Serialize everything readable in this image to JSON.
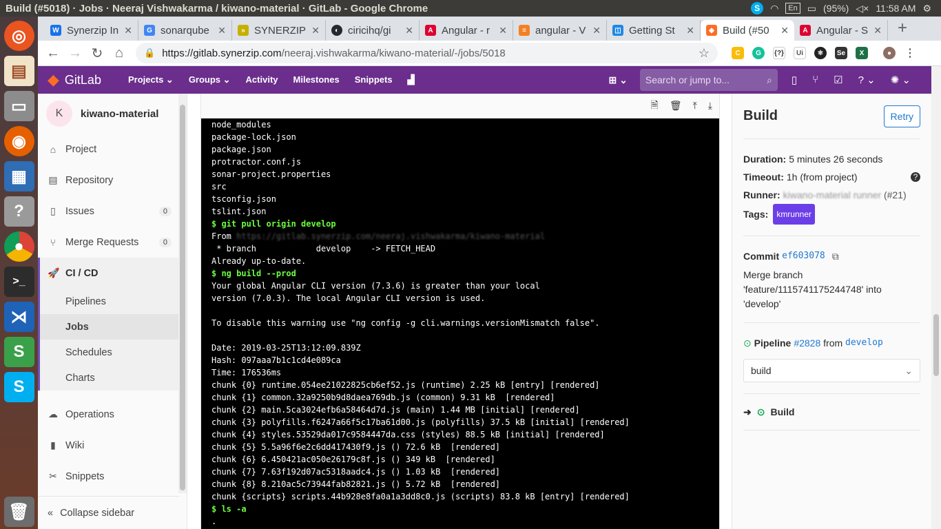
{
  "os": {
    "window_title": "Build (#5018) · Jobs · Neeraj Vishwakarma / kiwano-material · GitLab - Google Chrome",
    "lang": "En",
    "battery": "(95%)",
    "clock": "11:58 AM"
  },
  "browser": {
    "tabs": [
      {
        "title": "Synerzip In",
        "color": "#1a73e8"
      },
      {
        "title": "sonarqube",
        "color": "#4285f4"
      },
      {
        "title": "SYNERZIP",
        "color": "#c5b000"
      },
      {
        "title": "ciricihq/gi",
        "color": "#24292e"
      },
      {
        "title": "Angular - r",
        "color": "#dd0031"
      },
      {
        "title": "angular - V",
        "color": "#f48024"
      },
      {
        "title": "Getting St",
        "color": "#1e88e5"
      },
      {
        "title": "Build (#50",
        "color": "#fc6d26",
        "active": true
      },
      {
        "title": "Angular - S",
        "color": "#dd0031"
      }
    ],
    "url_host": "https://gitlab.synerzip.com",
    "url_path": "/neeraj.vishwakarma/kiwano-material/-/jobs/5018"
  },
  "gitlab": {
    "brand": "GitLab",
    "nav": [
      "Projects ⌄",
      "Groups ⌄",
      "Activity",
      "Milestones",
      "Snippets"
    ],
    "search_placeholder": "Search or jump to..."
  },
  "sidebar": {
    "project_initial": "K",
    "project_name": "kiwano-material",
    "items": [
      {
        "label": "Project"
      },
      {
        "label": "Repository"
      },
      {
        "label": "Issues",
        "count": "0"
      },
      {
        "label": "Merge Requests",
        "count": "0"
      },
      {
        "label": "CI / CD"
      }
    ],
    "cicd_sub": [
      "Pipelines",
      "Jobs",
      "Schedules",
      "Charts"
    ],
    "lower_items": [
      "Operations",
      "Wiki",
      "Snippets"
    ],
    "collapse": "Collapse sidebar"
  },
  "log": {
    "lines": [
      {
        "t": "node_modules"
      },
      {
        "t": "package-lock.json"
      },
      {
        "t": "package.json"
      },
      {
        "t": "protractor.conf.js"
      },
      {
        "t": "sonar-project.properties"
      },
      {
        "t": "src"
      },
      {
        "t": "tsconfig.json"
      },
      {
        "t": "tslint.json"
      },
      {
        "t": "$ git pull origin develop",
        "cmd": true
      },
      {
        "t": "From ",
        "blur": "https://gitlab.synerzip.com/neeraj.vishwakarma/kiwano-material"
      },
      {
        "t": " * branch            develop    -> FETCH_HEAD"
      },
      {
        "t": "Already up-to-date."
      },
      {
        "t": "$ ng build --prod",
        "cmd": true
      },
      {
        "t": "Your global Angular CLI version (7.3.6) is greater than your local"
      },
      {
        "t": "version (7.0.3). The local Angular CLI version is used."
      },
      {
        "t": ""
      },
      {
        "t": "To disable this warning use \"ng config -g cli.warnings.versionMismatch false\"."
      },
      {
        "t": ""
      },
      {
        "t": "Date: 2019-03-25T13:12:09.839Z"
      },
      {
        "t": "Hash: 097aaa7b1c1cd4e089ca"
      },
      {
        "t": "Time: 176536ms"
      },
      {
        "t": "chunk {0} runtime.054ee21022825cb6ef52.js (runtime) 2.25 kB [entry] [rendered]"
      },
      {
        "t": "chunk {1} common.32a9250b9d8daea769db.js (common) 9.31 kB  [rendered]"
      },
      {
        "t": "chunk {2} main.5ca3024efb6a58464d7d.js (main) 1.44 MB [initial] [rendered]"
      },
      {
        "t": "chunk {3} polyfills.f6247a66f5c17ba61d00.js (polyfills) 37.5 kB [initial] [rendered]"
      },
      {
        "t": "chunk {4} styles.53529da017c9584447da.css (styles) 88.5 kB [initial] [rendered]"
      },
      {
        "t": "chunk {5} 5.5a96f6e2c6dd417430f9.js () 72.6 kB  [rendered]"
      },
      {
        "t": "chunk {6} 6.450421ac050e26179c8f.js () 349 kB  [rendered]"
      },
      {
        "t": "chunk {7} 7.63f192d07ac5318aadc4.js () 1.03 kB  [rendered]"
      },
      {
        "t": "chunk {8} 8.210ac5c73944fab82821.js () 5.72 kB  [rendered]"
      },
      {
        "t": "chunk {scripts} scripts.44b928e8fa0a1a3dd8c0.js (scripts) 83.8 kB [entry] [rendered]"
      },
      {
        "t": "$ ls -a",
        "cmd": true
      },
      {
        "t": "."
      }
    ]
  },
  "job": {
    "title": "Build",
    "retry": "Retry",
    "duration_label": "Duration:",
    "duration": "5 minutes 26 seconds",
    "timeout_label": "Timeout:",
    "timeout": "1h (from project)",
    "runner_label": "Runner:",
    "runner_name": "kiwano-material runner",
    "runner_id": "(#21)",
    "tags_label": "Tags:",
    "tag": "kmrunner",
    "commit_label": "Commit",
    "commit_sha": "ef603078",
    "commit_message": "Merge branch 'feature/1115741175244748' into 'develop'",
    "pipeline_label": "Pipeline",
    "pipeline_id": "#2828",
    "pipeline_from": "from",
    "pipeline_branch": "develop",
    "stage_select": "build",
    "stage_job": "Build"
  }
}
